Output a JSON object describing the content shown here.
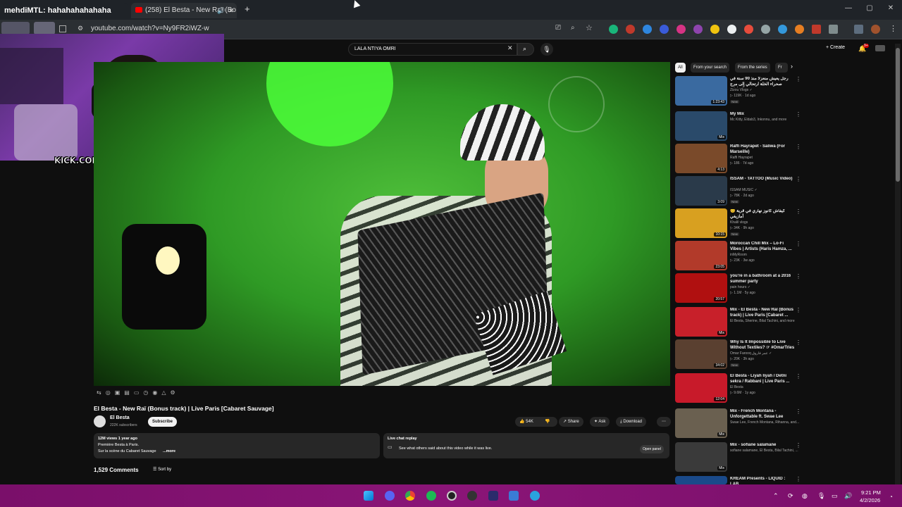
{
  "browser": {
    "tab1_label": "mehdiMTL: hahahahahahaha",
    "tab2_label": "(258) El Besta - New Raï (Bo",
    "new_tab": "+",
    "address": "youtube.com/watch?v=Ny9FR2iWZ-w",
    "win_min": "—",
    "win_max": "▢",
    "win_close": "✕"
  },
  "webcam": {
    "overlay_text": "KICK.COM/INFAMOUSS"
  },
  "youtube": {
    "search_value": "LALA NTIYA OMRI",
    "create_label": "Create",
    "notif_count": "9+",
    "chips": [
      "All",
      "From your search",
      "From the series",
      "Fr"
    ],
    "video_title": "El Besta - New Raï (Bonus track) | Live Paris [Cabaret Sauvage]",
    "channel_name": "El Besta",
    "subscribers": "222K subscribers",
    "subscribe_label": "Subscribe",
    "likes": "54K",
    "share_label": "Share",
    "ask_label": "Ask",
    "download_label": "Download",
    "desc_stats": "12M views  1 year ago",
    "desc_line1": "Première Besta à Paris.",
    "desc_line2": "Sur la scène du Cabaret Sauvage",
    "desc_more": "...more",
    "live_chat_title": "Live chat replay",
    "live_chat_desc": "See what others said about this video while it was live.",
    "open_panel": "Open panel",
    "comments_count": "1,529 Comments",
    "sort_by": "Sort by"
  },
  "related": [
    {
      "title": "رجل يعيش منعزلاً منذ 90 سنة في صحراء الخلة ارتحالي إلى مرج الشاطئ",
      "channel": "Zizou Vlogs ✓",
      "stats": "▷ 119K · 1d ago",
      "duration": "1:23:43",
      "badge": "New"
    },
    {
      "title": "My Mix",
      "channel": "Mc Kitty, Eldab3, Inkonnu, and more",
      "stats": "",
      "duration": "Mix",
      "badge": ""
    },
    {
      "title": "Raffi Hayrapet - Saliwa (For Marseille)",
      "channel": "Raffi Hayrapet",
      "stats": "▷ 186 · 7d ago",
      "duration": "4:13",
      "badge": ""
    },
    {
      "title": "ISSAM - TATTOO (Music Video)",
      "channel": "ISSAM MUSIC ✓",
      "stats": "▷ 78K · 2d ago",
      "duration": "3:09",
      "badge": "New"
    },
    {
      "title": "😊 كيفاش كانوز نهاري في قرية أمازيغي",
      "channel": "Khalil vlogs",
      "stats": "▷ 34K · 9h ago",
      "duration": "10:15",
      "badge": "New"
    },
    {
      "title": "Moroccan Chill Mix – Lo-Fi Vibes | Artists (Haris Hamza, ...",
      "channel": "inMyRoom",
      "stats": "▷ 23K · 3w ago",
      "duration": "23:05",
      "badge": ""
    },
    {
      "title": "you're in a bathroom at a 2016 summer party",
      "channel": "pain hours ✓",
      "stats": "▷ 1.1M · 5y ago",
      "duration": "20:57",
      "badge": ""
    },
    {
      "title": "Mix - El Besta - New Raï (Bonus track) | Live Paris [Cabaret ...",
      "channel": "El Besta, Sherine, Bilal Tachini, and more",
      "stats": "",
      "duration": "Mix",
      "badge": ""
    },
    {
      "title": "Why Is It Impossible to Live Without Textiles? ☞ #OmarTries",
      "channel": "Omar Farooq عمر فاروق ✓",
      "stats": "▷ 20K · 3h ago",
      "duration": "34:02",
      "badge": "New"
    },
    {
      "title": "El Besta - Liyah liyah / Detni sekra / Rabbani | Live Paris ...",
      "channel": "El Besta",
      "stats": "▷ 9.6M · 1y ago",
      "duration": "12:04",
      "badge": ""
    },
    {
      "title": "Mix - French Montana - Unforgettable ft. Swae Lee",
      "channel": "Swae Lee, French Montana, Rihanna, and...",
      "stats": "",
      "duration": "Mix",
      "badge": ""
    },
    {
      "title": "Mix - sofiane salamane",
      "channel": "sofiane salamane, El Besta, Bilal Tachini, ...",
      "stats": "",
      "duration": "Mix",
      "badge": ""
    },
    {
      "title": "KREAM Presents - LIQUID : LAB",
      "channel": "",
      "stats": "",
      "duration": "",
      "badge": ""
    }
  ],
  "taskbar": {
    "time": "9:21 PM",
    "date": "4/2/2026"
  },
  "colors": {
    "taskbar": "#8a1577",
    "webcam_bg": "#7a3aa8",
    "video_green": "#3ca82e"
  }
}
